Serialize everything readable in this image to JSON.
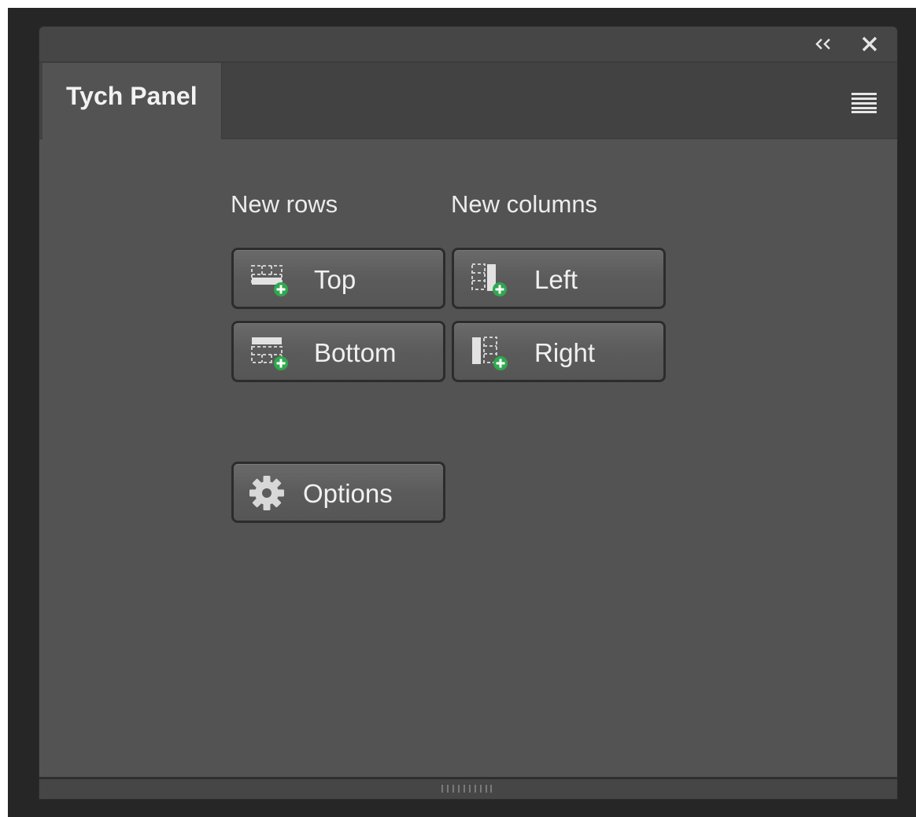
{
  "panel": {
    "tab_title": "Tych Panel"
  },
  "titlebar": {
    "collapse_icon": "double-chevron-left-icon",
    "close_icon": "close-icon"
  },
  "sections": {
    "rows_label": "New rows",
    "columns_label": "New columns"
  },
  "buttons": {
    "top": "Top",
    "bottom": "Bottom",
    "left": "Left",
    "right": "Right",
    "options": "Options"
  },
  "colors": {
    "panel_bg": "#535353",
    "tab_bar_bg": "#424242",
    "button_bg": "#5e5e5e",
    "plus_green": "#2fa84f",
    "text": "#f0f0f0"
  }
}
